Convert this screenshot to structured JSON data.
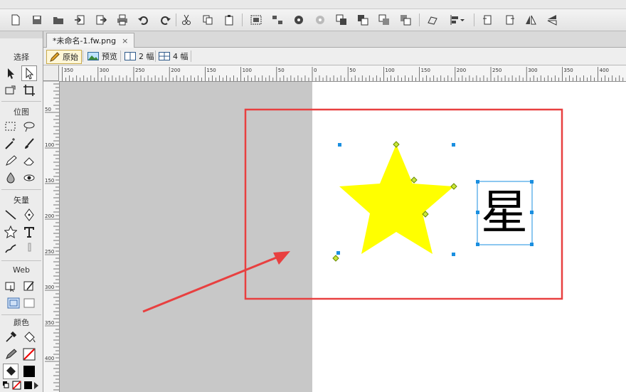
{
  "document_tab": {
    "title": "*未命名-1.fw.png",
    "close_glyph": "×"
  },
  "view_modes": [
    {
      "label": "原始",
      "icon": "pencil-icon",
      "active": true
    },
    {
      "label": "预览",
      "icon": "landscape-preview-icon",
      "active": false
    },
    {
      "label": "2 幅",
      "icon": "two-up-icon",
      "active": false
    },
    {
      "label": "4 幅",
      "icon": "four-up-icon",
      "active": false
    }
  ],
  "tools_panel": {
    "sections": {
      "select": "选择",
      "bitmap": "位图",
      "vector": "矢量",
      "web": "Web",
      "color": "颜色"
    }
  },
  "ruler": {
    "h_labels": [
      "350",
      "300",
      "250",
      "200",
      "150",
      "100",
      "50",
      "0",
      "50",
      "100",
      "150",
      "200",
      "250",
      "300",
      "350",
      "400"
    ],
    "v_labels": [
      "50",
      "100",
      "150",
      "200",
      "250",
      "300",
      "350",
      "400"
    ]
  },
  "canvas": {
    "star_color": "#ffff00",
    "text_object": "星",
    "annotation_color": "#e84040",
    "handle_color": "#1a8fe0"
  }
}
